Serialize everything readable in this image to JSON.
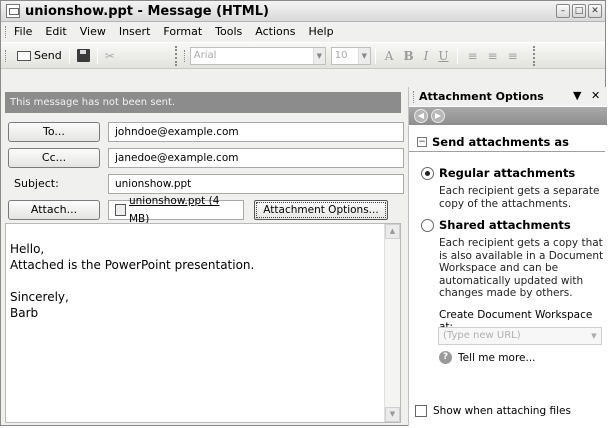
{
  "window": {
    "title": "unionshow.ppt - Message (HTML)",
    "controls": [
      "minimize",
      "maximize",
      "close"
    ]
  },
  "menu": {
    "items": [
      "File",
      "Edit",
      "View",
      "Insert",
      "Format",
      "Tools",
      "Actions",
      "Help"
    ]
  },
  "toolbar": {
    "send_label": "Send",
    "font_name": "Arial",
    "font_size": "10",
    "format_glyphs": [
      "A",
      "B",
      "I",
      "U"
    ]
  },
  "infobar": {
    "text": "This message has not been sent."
  },
  "header": {
    "to_button": "To...",
    "to_value": "johndoe@example.com",
    "cc_button": "Cc...",
    "cc_value": "janedoe@example.com",
    "subject_label": "Subject:",
    "subject_value": "unionshow.ppt",
    "attach_button": "Attach...",
    "attachment_name": "unionshow.ppt (4 MB)",
    "attachment_options_button": "Attachment Options..."
  },
  "body": {
    "text": "Hello,\nAttached is the PowerPoint presentation.\n\nSincerely,\nBarb"
  },
  "pane": {
    "title": "Attachment Options",
    "section_title": "Send attachments as",
    "regular_title": "Regular attachments",
    "regular_desc": "Each recipient gets a separate copy of the attachments.",
    "shared_title": "Shared attachments",
    "shared_desc": "Each recipient gets a copy that is also available in a Document Workspace and can be automatically updated with changes made by others.",
    "workspace_label": "Create Document Workspace at:",
    "workspace_placeholder": "(Type new URL)",
    "tell_more": "Tell me more...",
    "show_when_attaching": "Show when attaching files",
    "selected_option": "regular"
  }
}
